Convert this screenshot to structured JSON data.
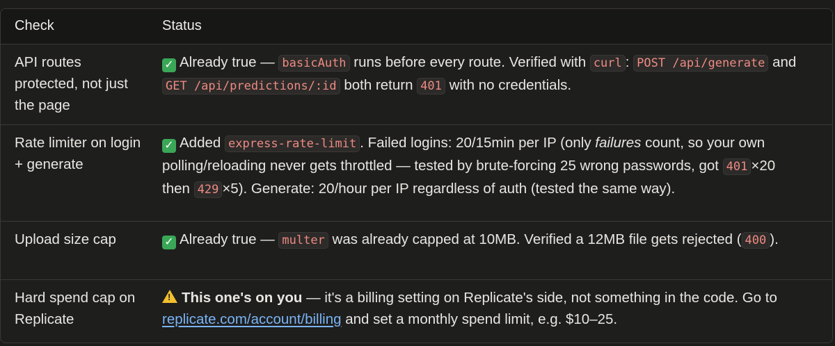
{
  "table": {
    "headers": {
      "check": "Check",
      "status": "Status"
    },
    "rows": [
      {
        "check": "API routes protected, not just the page",
        "status": {
          "t1": "Already true — ",
          "c1": "basicAuth",
          "t2": " runs before every route. Verified with ",
          "c2": "curl",
          "t3": ": ",
          "c3": "POST /api/generate",
          "t4": " and ",
          "c4": "GET /api/predictions/:id",
          "t5": " both return ",
          "c5": "401",
          "t6": " with no credentials."
        }
      },
      {
        "check": "Rate limiter on login + generate",
        "status": {
          "t1": "Added ",
          "c1": "express-rate-limit",
          "t2": ". Failed logins: 20/15min per IP (only ",
          "em": "failures",
          "t3": " count, so your own polling/reloading never gets throttled — tested by brute-forcing 25 wrong passwords, got ",
          "c2": "401",
          "t4": "×20 then ",
          "c3": "429",
          "t5": "×5). Generate: 20/hour per IP regardless of auth (tested the same way)."
        }
      },
      {
        "check": "Upload size cap",
        "status": {
          "t1": "Already true — ",
          "c1": "multer",
          "t2": " was already capped at 10MB. Verified a 12MB file gets rejected (",
          "c2": "400",
          "t3": ")."
        }
      },
      {
        "check": "Hard spend cap on Replicate",
        "status": {
          "bold": "This one's on you",
          "t1": " — it's a billing setting on Replicate's side, not something in the code. Go to ",
          "link": "replicate.com/account/billing",
          "t2": " and set a monthly spend limit, e.g. $10–25."
        }
      }
    ]
  },
  "icons": {
    "check": "check-mark-icon",
    "warning": "warning-icon"
  },
  "colors": {
    "code_text": "#ee8a83",
    "link": "#7ab4f5",
    "check_green": "#3aa757",
    "warning_yellow": "#f2c02e"
  }
}
